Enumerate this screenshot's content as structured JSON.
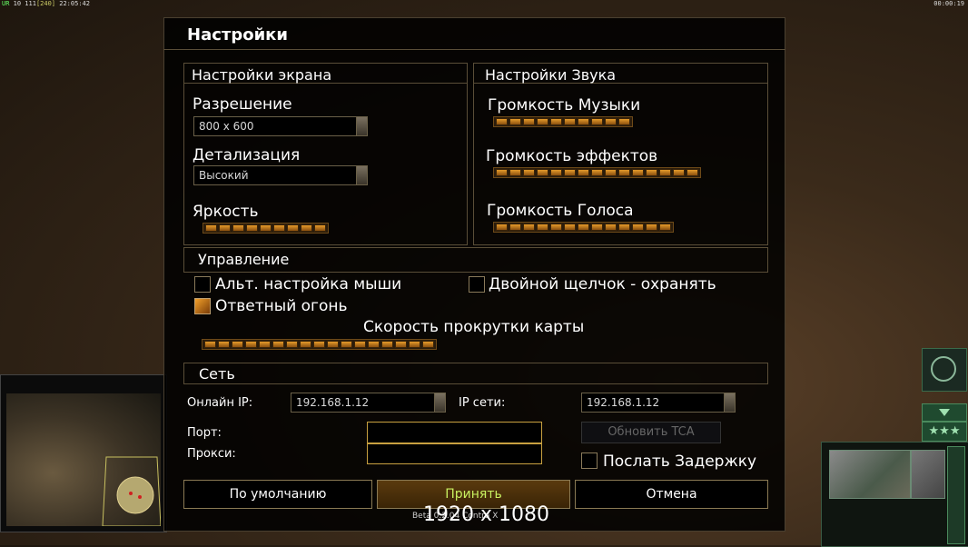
{
  "hud": {
    "left_prefix": "UR",
    "left_value": "10 111",
    "left_bracket": "[240]",
    "left_time": "22:05:42",
    "right_time": "00:00:19"
  },
  "dialog": {
    "title": "Настройки"
  },
  "screen": {
    "title": "Настройки экрана",
    "resolution_label": "Разрешение",
    "resolution_value": "800 x 600",
    "detail_label": "Детализация",
    "detail_value": "Высокий",
    "brightness_label": "Яркость",
    "brightness_segments": 9
  },
  "sound": {
    "title": "Настройки Звука",
    "music_label": "Громкость Музыки",
    "music_segments": 10,
    "effects_label": "Громкость эффектов",
    "effects_segments": 15,
    "voice_label": "Громкость Голоса",
    "voice_segments": 13
  },
  "control": {
    "title": "Управление",
    "alt_mouse_label": "Альт. настройка мыши",
    "alt_mouse_checked": false,
    "double_click_label": "Двойной щелчок - охранять",
    "double_click_checked": false,
    "return_fire_label": "Ответный огонь",
    "return_fire_checked": true,
    "scroll_label": "Скорость прокрутки карты",
    "scroll_segments": 17
  },
  "network": {
    "title": "Сеть",
    "online_ip_label": "Онлайн IP:",
    "online_ip_value": "192.168.1.12",
    "lan_ip_label": "IP сети:",
    "lan_ip_value": "192.168.1.12",
    "port_label": "Порт:",
    "port_value": "",
    "proxy_label": "Прокси:",
    "proxy_value": "",
    "update_tca_label": "Обновить TCA",
    "send_delay_label": "Послать Задержку",
    "send_delay_checked": false
  },
  "buttons": {
    "defaults": "По умолчанию",
    "accept": "Принять",
    "cancel": "Отмена"
  },
  "overlay": {
    "resolution_text": "1920 x 1080",
    "version_text": "Beta 0.2.04 Contra X"
  },
  "colors": {
    "slider_fill": "#e59a2a",
    "accent_text": "#c8f060",
    "panel_border": "#5a4e38"
  }
}
